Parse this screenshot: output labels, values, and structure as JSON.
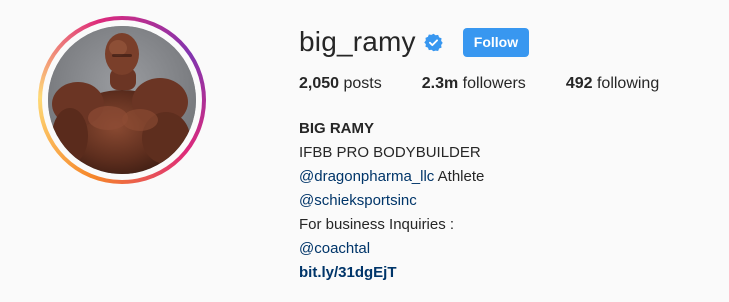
{
  "profile": {
    "username": "big_ramy",
    "verified": true,
    "follow_label": "Follow",
    "accent_color": "#3897f0"
  },
  "stats": {
    "posts_count": "2,050",
    "posts_label": "posts",
    "followers_count": "2.3m",
    "followers_label": "followers",
    "following_count": "492",
    "following_label": "following"
  },
  "bio": {
    "name": "BIG RAMY",
    "line1": "IFBB PRO BODYBUILDER",
    "mention1": "@dragonpharma_llc",
    "line2_suffix": " Athlete",
    "mention2": "@schieksportsinc",
    "line3": "For business Inquiries :",
    "mention3": "@coachtal",
    "link": "bit.ly/31dgEjT"
  },
  "icons": {
    "verified": "verified-badge-icon"
  }
}
